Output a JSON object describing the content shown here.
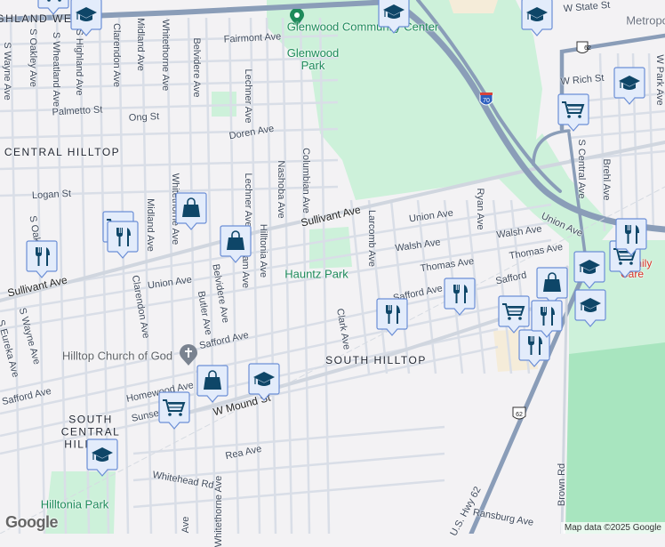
{
  "colors": {
    "background": "#f3f2f4",
    "park": "#cdf1da",
    "park_dark": "#a8e5bf",
    "highway": "#8a9db8",
    "street": "#d8dde6",
    "marker_fill": "#e3ecfb",
    "marker_border": "#6b8ed6",
    "marker_icon": "#0e4668",
    "poi_green": "#1e8a5a"
  },
  "areas": [
    "HIGHLAND WEST",
    "CENTRAL HILLTOP",
    "SOUTH HILLTOP",
    "SOUTH CENTRAL HILLTOP",
    "Metropolitan"
  ],
  "pois": {
    "glenwood_cc": "Glenwood Community Center",
    "glenwood_park": "Glenwood Park",
    "hauntz_park": "Hauntz Park",
    "church": "Hilltop Church of God",
    "hilltonia_park": "Hilltonia Park",
    "family_care": "Family Care"
  },
  "streets": {
    "s_wayne": "S Wayne Ave",
    "s_oakley": "S Oakley Ave",
    "s_wheatland": "S Wheatland Ave",
    "s_highland": "S Highland Ave",
    "clarendon": "Clarendon Ave",
    "midland": "Midland Ave",
    "whitethorne": "Whitethorne Ave",
    "belvidere": "Belvidere Ave",
    "lechner": "Lechner Ave",
    "nashoba": "Nashoba Ave",
    "columbian": "Columbian Ave",
    "hilltonia": "Hilltonia Ave",
    "wrexham": "xham Ave",
    "larcomb": "Larcomb Ave",
    "ryan": "Ryan Ave",
    "s_central": "S Central Ave",
    "brehl": "Brehl Ave",
    "w_park": "W Park Ave",
    "butler": "Butler Ave",
    "clark": "Clark Ave",
    "s_eureka": "S Eureka Ave",
    "brown": "Brown Rd",
    "fairmont": "Fairmont Ave",
    "palmetto": "Palmetto St",
    "ong": "Ong St",
    "doren": "Doren Ave",
    "logan": "Logan St",
    "sullivant": "Sullivant Ave",
    "union": "Union Ave",
    "walsh": "Walsh Ave",
    "thomas": "Thomas Ave",
    "safford": "Safford Ave",
    "safford_short": "Safford",
    "homewood": "Homewood Ave",
    "w_mound": "W Mound St",
    "rea": "Rea Ave",
    "whitehead": "Whitehead Rd",
    "w_state": "W State St",
    "w_rich": "W Rich St",
    "ransburg": "Ransburg Ave",
    "us62": "U.S. Hwy 62",
    "sunset": "Sunset Dr",
    "ave": "Ave"
  },
  "shields": {
    "i70": "70",
    "us62": "62"
  },
  "markers": [
    {
      "type": "school"
    },
    {
      "type": "school"
    },
    {
      "type": "school"
    },
    {
      "type": "school"
    },
    {
      "type": "school"
    },
    {
      "type": "school"
    },
    {
      "type": "school"
    },
    {
      "type": "school"
    },
    {
      "type": "shopping"
    },
    {
      "type": "shopping"
    },
    {
      "type": "shopping"
    },
    {
      "type": "shopping"
    },
    {
      "type": "grocery"
    },
    {
      "type": "grocery"
    },
    {
      "type": "grocery"
    },
    {
      "type": "grocery"
    },
    {
      "type": "grocery"
    },
    {
      "type": "grocery"
    },
    {
      "type": "restaurant"
    },
    {
      "type": "restaurant"
    },
    {
      "type": "restaurant"
    },
    {
      "type": "restaurant"
    },
    {
      "type": "restaurant"
    },
    {
      "type": "restaurant"
    },
    {
      "type": "restaurant"
    }
  ],
  "attribution": {
    "logo": "Google",
    "map_data": "Map data ©2025 Google"
  }
}
